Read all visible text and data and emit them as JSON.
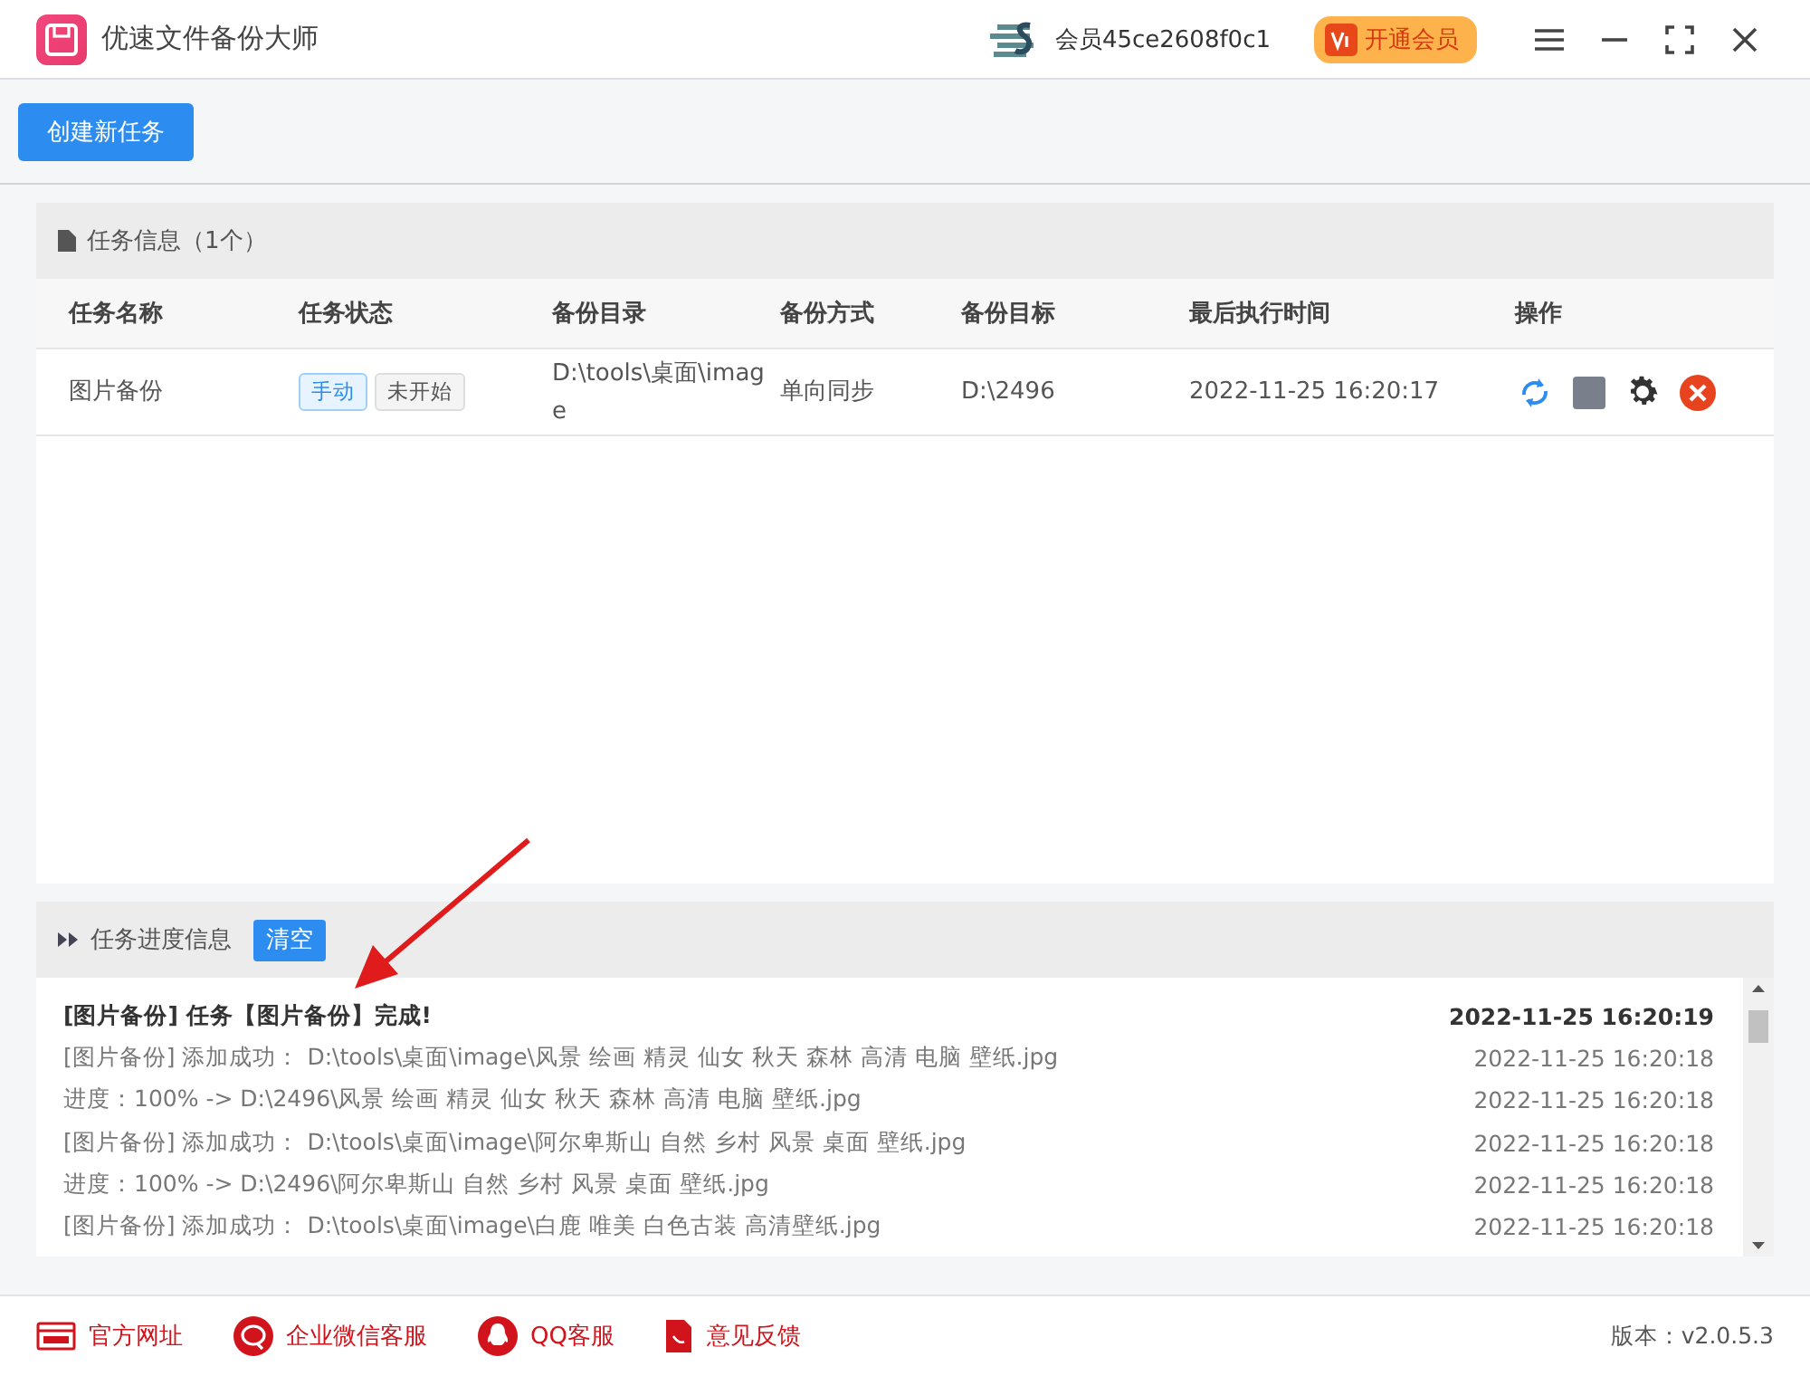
{
  "window": {
    "title": "优速文件备份大师",
    "user": "会员45ce2608f0c1",
    "vip_button": "开通会员"
  },
  "toolbar": {
    "create_button": "创建新任务"
  },
  "task_panel": {
    "title": "任务信息（1个）",
    "columns": [
      "任务名称",
      "任务状态",
      "备份目录",
      "备份方式",
      "备份目标",
      "最后执行时间",
      "操作"
    ],
    "rows": [
      {
        "name": "图片备份",
        "tags": [
          {
            "label": "手动",
            "kind": "mode"
          },
          {
            "label": "未开始",
            "kind": "state"
          }
        ],
        "source": "D:\\tools\\桌面\\image",
        "method": "单向同步",
        "target": "D:\\2496",
        "last_run": "2022-11-25 16:20:17"
      }
    ]
  },
  "progress_panel": {
    "title": "任务进度信息",
    "clear_button": "清空",
    "log": [
      {
        "text": "[图片备份] 任务【图片备份】完成!",
        "time": "2022-11-25 16:20:19",
        "kind": "summary"
      },
      {
        "text": "[图片备份] 添加成功：  D:\\tools\\桌面\\image\\风景 绘画 精灵 仙女 秋天 森林 高清 电脑 壁纸.jpg",
        "time": "2022-11-25 16:20:18",
        "kind": "detail"
      },
      {
        "text": "进度：100% -> D:\\2496\\风景 绘画 精灵 仙女 秋天 森林 高清 电脑 壁纸.jpg",
        "time": "2022-11-25 16:20:18",
        "kind": "detail"
      },
      {
        "text": "[图片备份] 添加成功：  D:\\tools\\桌面\\image\\阿尔卑斯山 自然 乡村 风景 桌面 壁纸.jpg",
        "time": "2022-11-25 16:20:18",
        "kind": "detail"
      },
      {
        "text": "进度：100% -> D:\\2496\\阿尔卑斯山 自然 乡村 风景 桌面 壁纸.jpg",
        "time": "2022-11-25 16:20:18",
        "kind": "detail"
      },
      {
        "text": "[图片备份] 添加成功：  D:\\tools\\桌面\\image\\白鹿 唯美 白色古装 高清壁纸.jpg",
        "time": "2022-11-25 16:20:18",
        "kind": "detail"
      }
    ]
  },
  "footer": {
    "links": [
      {
        "label": "官方网址",
        "kind": "web"
      },
      {
        "label": "企业微信客服",
        "kind": "wechat"
      },
      {
        "label": "QQ客服",
        "kind": "qq"
      },
      {
        "label": "意见反馈",
        "kind": "feedback"
      }
    ],
    "version": "版本：v2.0.5.3"
  }
}
